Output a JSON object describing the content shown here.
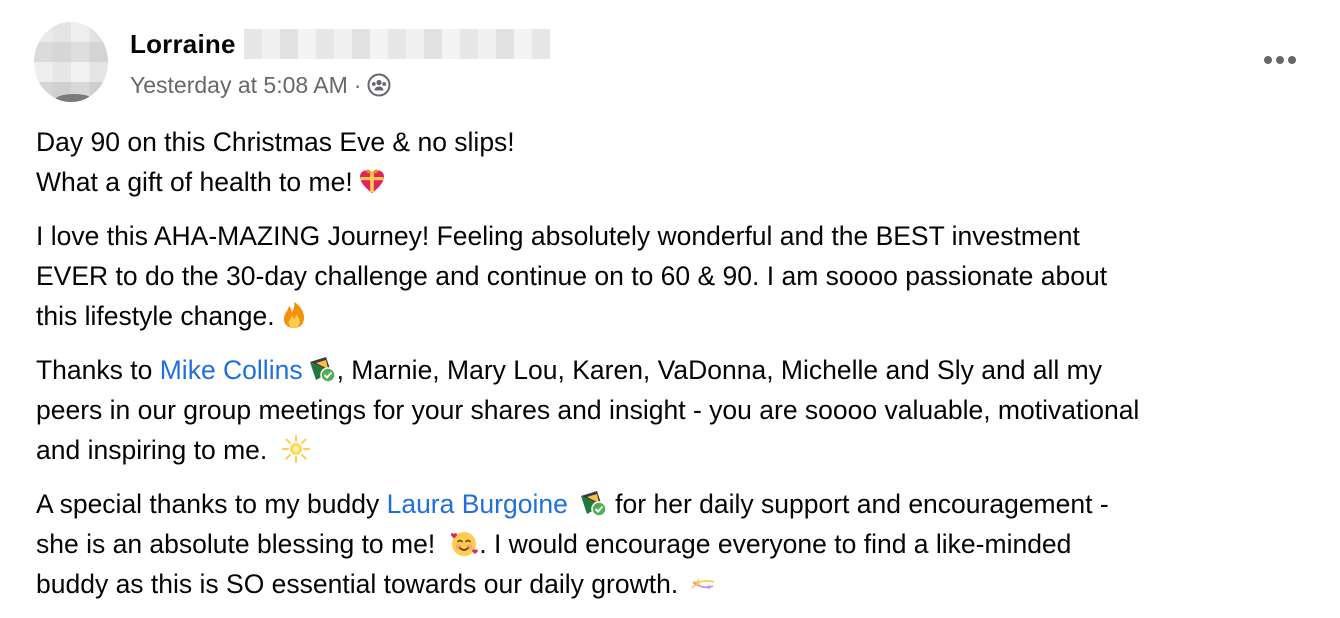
{
  "author": {
    "name": "Lorraine"
  },
  "meta": {
    "timestamp": "Yesterday at 5:08 AM",
    "separator": "·",
    "audience_icon": "group-icon"
  },
  "more_button": {
    "icon": "more-horizontal-icon"
  },
  "post": {
    "p1": {
      "line1": "Day 90 on this Christmas Eve & no slips!",
      "line2": "What a gift of health to me!",
      "emoji": "gift-heart-emoji"
    },
    "p2": {
      "line1": "I love this AHA-MAZING Journey!  Feeling absolutely wonderful and the BEST investment",
      "line2": "EVER to do the 30-day challenge and continue on to 60 & 90.  I am soooo passionate about",
      "line3": "this lifestyle change.",
      "emoji": "fire-emoji"
    },
    "p3": {
      "prefix": "Thanks to ",
      "mention": "Mike Collins",
      "badge": "member-badge-icon",
      "line1_rest": ", Marnie, Mary Lou, Karen, VaDonna, Michelle and Sly and all my",
      "line2": "peers in our group meetings for your shares and insight - you are soooo valuable, motivational",
      "line3": "and inspiring to me.",
      "emoji": "sparkle-sun-emoji"
    },
    "p4": {
      "prefix": "A special thanks to my buddy ",
      "mention": "Laura Burgoine",
      "badge": "member-badge-icon",
      "line1_rest": " for her daily support and encouragement -",
      "line2a": "she is an absolute blessing to me!",
      "line2_emoji": "smiling-hearts-emoji",
      "line2b": ". I would encourage everyone to find a like-minded",
      "line3": "buddy as this is SO essential towards our daily growth.",
      "emoji": "dizzy-stars-emoji"
    }
  },
  "colors": {
    "text": "#050505",
    "secondary": "#65676b",
    "link": "#216fdb"
  }
}
